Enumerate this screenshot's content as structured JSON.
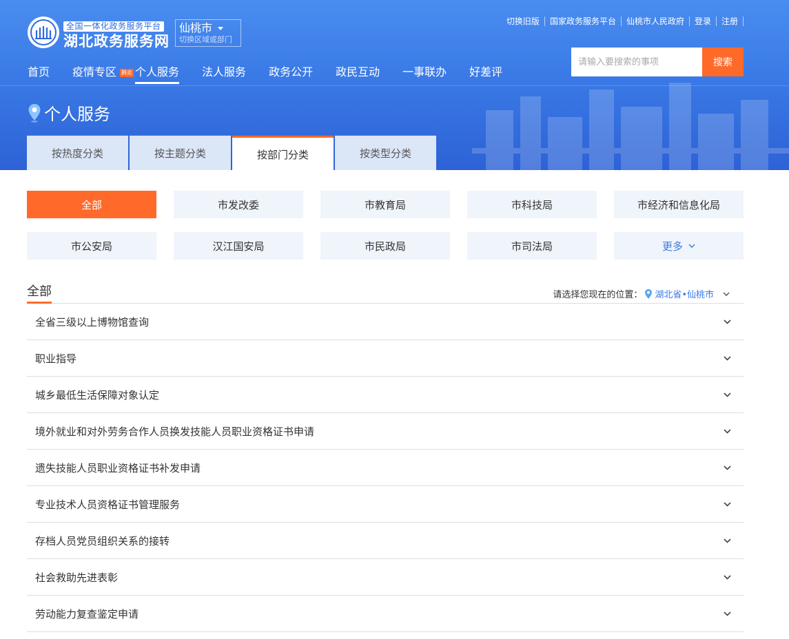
{
  "header": {
    "platform_tag": "全国一体化政务服务平台",
    "site_name": "湖北政务服务网",
    "city": "仙桃市",
    "city_hint": "切换区域或部门",
    "top_links": [
      "切换旧版",
      "国家政务服务平台",
      "仙桃市人民政府",
      "登录",
      "注册"
    ],
    "search": {
      "placeholder": "请输入要搜索的事项",
      "button": "搜索"
    },
    "nav": [
      {
        "label": "首页"
      },
      {
        "label": "疫情专区",
        "badge": "肺炎"
      },
      {
        "label": "个人服务",
        "active": true
      },
      {
        "label": "法人服务"
      },
      {
        "label": "政务公开"
      },
      {
        "label": "政民互动"
      },
      {
        "label": "一事联办"
      },
      {
        "label": "好差评"
      }
    ],
    "page_title": "个人服务"
  },
  "category_tabs": [
    {
      "label": "按热度分类"
    },
    {
      "label": "按主题分类"
    },
    {
      "label": "按部门分类",
      "active": true
    },
    {
      "label": "按类型分类"
    }
  ],
  "departments": [
    {
      "label": "全部",
      "active": true
    },
    {
      "label": "市发改委"
    },
    {
      "label": "市教育局"
    },
    {
      "label": "市科技局"
    },
    {
      "label": "市经济和信息化局"
    },
    {
      "label": "市公安局"
    },
    {
      "label": "汉江国安局"
    },
    {
      "label": "市民政局"
    },
    {
      "label": "市司法局"
    },
    {
      "label": "更多",
      "more": true
    }
  ],
  "section": {
    "title": "全部",
    "location_prompt": "请选择您现在的位置：",
    "location": "湖北省•仙桃市"
  },
  "services": [
    "全省三级以上博物馆查询",
    "职业指导",
    "城乡最低生活保障对象认定",
    "境外就业和对外劳务合作人员换发技能人员职业资格证书申请",
    "遗失技能人员职业资格证书补发申请",
    "专业技术人员资格证书管理服务",
    "存档人员党员组织关系的接转",
    "社会救助先进表彰",
    "劳动能力复查鉴定申请"
  ],
  "colors": {
    "accent": "#ff6a2b",
    "brand_blue": "#3a7ae6",
    "tab_bg": "#dbe6f7",
    "dept_bg": "#f0f4fb"
  }
}
